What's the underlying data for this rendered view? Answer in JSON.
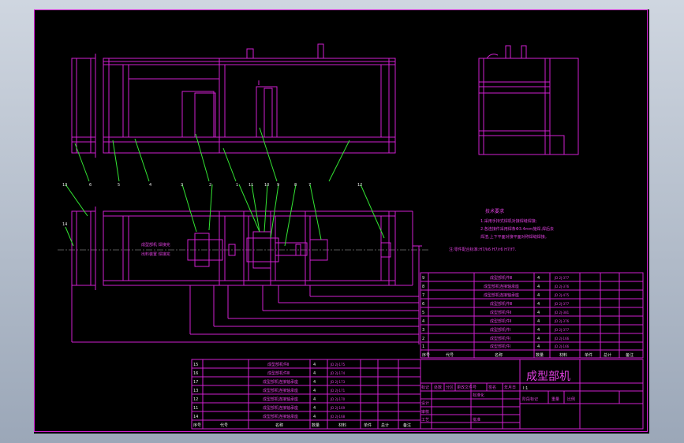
{
  "drawing": {
    "title": "成型部机",
    "scale": "Ⅰ:1",
    "notes_heading": "技术要求",
    "notes": [
      "1.采用手持式焊机对接焊缝焊接;",
      "2.各连接件采用焊条Φ3.4mm施焊,焊后去",
      "焊渣,上下平面对接平面对称焊缝焊接。",
      "注:零件配合标准:H7/k6 H7/r6 H7/f7."
    ],
    "plan_labels": [
      "成型部机 焊接完",
      "出料装置 焊接完"
    ],
    "balloons_top": [
      "6",
      "5",
      "4",
      "3",
      "2",
      "1",
      "11",
      "10",
      "9",
      "8",
      "7",
      "12"
    ],
    "balloons_left": [
      "13",
      "14"
    ]
  },
  "parts_upper": [
    {
      "no": "9",
      "name": "成型部机件Ⅲ",
      "qty": "4",
      "code": "JD 2J-377"
    },
    {
      "no": "8",
      "name": "成型部机连接轴承座",
      "qty": "4",
      "code": "JD 2J-376"
    },
    {
      "no": "7",
      "name": "成型部机连接轴承座",
      "qty": "4",
      "code": "JD 2J-475"
    },
    {
      "no": "6",
      "name": "成型部机件Ⅲ",
      "qty": "4",
      "code": "JD 2J-377"
    },
    {
      "no": "5",
      "name": "成型部机件Ⅱ",
      "qty": "4",
      "code": "JD 2J-381"
    },
    {
      "no": "4",
      "name": "成型部机件Ⅱ",
      "qty": "4",
      "code": "JD 2J-376"
    },
    {
      "no": "3",
      "name": "成型部机件Ⅰ",
      "qty": "4",
      "code": "JD 2J-377"
    },
    {
      "no": "2",
      "name": "成型部机件Ⅰ",
      "qty": "4",
      "code": "JD 2J-166"
    },
    {
      "no": "1",
      "name": "成型部机件Ⅰ",
      "qty": "4",
      "code": "JD 2J-166"
    }
  ],
  "parts_lower": [
    {
      "no": "15",
      "name": "成型部机件Ⅱ",
      "qty": "4",
      "code": "JD 2J-175"
    },
    {
      "no": "16",
      "name": "成型部机件Ⅲ",
      "qty": "4",
      "code": "JD 2J-174"
    },
    {
      "no": "17",
      "name": "成型部机连接轴承座",
      "qty": "4",
      "code": "JD 2J-173"
    },
    {
      "no": "13",
      "name": "成型部机连接轴承座",
      "qty": "4",
      "code": "JD 2J-171"
    },
    {
      "no": "12",
      "name": "成型部机连接轴承座",
      "qty": "4",
      "code": "JD 2J-170"
    },
    {
      "no": "11",
      "name": "成型部机连接轴承座",
      "qty": "4",
      "code": "JD 2J-169"
    },
    {
      "no": "14",
      "name": "成型部机连接轴承座",
      "qty": "4",
      "code": "JD 2J-168"
    }
  ],
  "bom_header": [
    "序号",
    "代号",
    "名称",
    "数量",
    "材料",
    "单件",
    "总计",
    "备注"
  ],
  "title_block": {
    "rev_row": [
      "标记",
      "处数",
      "分区",
      "更改文件号",
      "签名",
      "年月日"
    ],
    "designer": "设计",
    "standardization": "标准化",
    "stage_labels": [
      "阶段标记",
      "重量",
      "比例"
    ],
    "review": "审核",
    "process": "工艺",
    "approve": "批准",
    "header_left": [
      "序号",
      "代号"
    ],
    "header_name": "名称",
    "header_qty": "数量",
    "header_mat": "材料",
    "header_right": [
      "单件",
      "总计",
      "备注"
    ]
  },
  "colors": {
    "background": "#000000",
    "line": "#d11fd1",
    "leader": "#33e633",
    "frame": "#bfc8d4"
  }
}
